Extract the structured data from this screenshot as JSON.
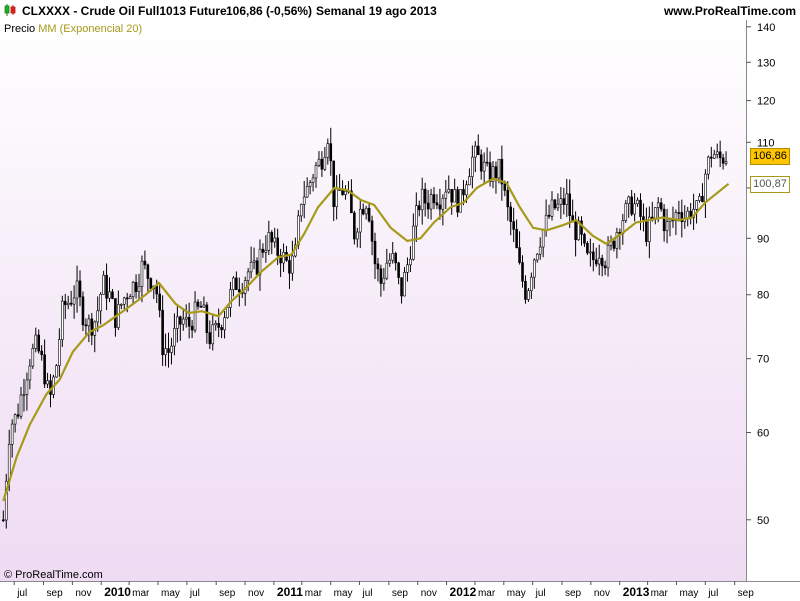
{
  "header": {
    "symbol": "CLXXXX - Crude Oil Full1013 Future",
    "price_change": "106,86 (-0,56%)",
    "period_date": "Semanal  19 ago 2013",
    "site": "www.ProRealTime.com"
  },
  "legend": {
    "price_label": "Precio",
    "ma_label": "MM (Exponencial 20)"
  },
  "copyright": "© ProRealTime.com",
  "colors": {
    "candle": "#000000",
    "ma": "#a69a18",
    "last_box": "#ffc600",
    "ma_box": "#ffffff"
  },
  "chart_data": {
    "type": "candlestick",
    "scale": "log",
    "ylim": [
      44,
      142
    ],
    "y_ticks": [
      140,
      130,
      120,
      110,
      100,
      90,
      80,
      70,
      60,
      50
    ],
    "x_ticks": [
      {
        "label": "jul",
        "x": "2009-07"
      },
      {
        "label": "sep",
        "x": "2009-09"
      },
      {
        "label": "nov",
        "x": "2009-11"
      },
      {
        "label": "2010",
        "x": "2010-01",
        "bold": true
      },
      {
        "label": "mar",
        "x": "2010-03"
      },
      {
        "label": "may",
        "x": "2010-05"
      },
      {
        "label": "jul",
        "x": "2010-07"
      },
      {
        "label": "sep",
        "x": "2010-09"
      },
      {
        "label": "nov",
        "x": "2010-11"
      },
      {
        "label": "2011",
        "x": "2011-01",
        "bold": true
      },
      {
        "label": "mar",
        "x": "2011-03"
      },
      {
        "label": "may",
        "x": "2011-05"
      },
      {
        "label": "jul",
        "x": "2011-07"
      },
      {
        "label": "sep",
        "x": "2011-09"
      },
      {
        "label": "nov",
        "x": "2011-11"
      },
      {
        "label": "2012",
        "x": "2012-01",
        "bold": true
      },
      {
        "label": "mar",
        "x": "2012-03"
      },
      {
        "label": "may",
        "x": "2012-05"
      },
      {
        "label": "jul",
        "x": "2012-07"
      },
      {
        "label": "sep",
        "x": "2012-09"
      },
      {
        "label": "nov",
        "x": "2012-11"
      },
      {
        "label": "2013",
        "x": "2013-01",
        "bold": true
      },
      {
        "label": "mar",
        "x": "2013-03"
      },
      {
        "label": "may",
        "x": "2013-05"
      },
      {
        "label": "jul",
        "x": "2013-07"
      },
      {
        "label": "sep",
        "x": "2013-09"
      }
    ],
    "close_series": {
      "name": "Precio",
      "points": [
        [
          "2009-06-08",
          50
        ],
        [
          "2009-06-22",
          61
        ],
        [
          "2009-07-06",
          62
        ],
        [
          "2009-07-20",
          66
        ],
        [
          "2009-08-03",
          70
        ],
        [
          "2009-08-17",
          72
        ],
        [
          "2009-08-31",
          69
        ],
        [
          "2009-09-14",
          64
        ],
        [
          "2009-09-28",
          69
        ],
        [
          "2009-10-12",
          78
        ],
        [
          "2009-10-26",
          79
        ],
        [
          "2009-11-09",
          81
        ],
        [
          "2009-11-23",
          77
        ],
        [
          "2009-12-07",
          75
        ],
        [
          "2009-12-21",
          76
        ],
        [
          "2010-01-04",
          82
        ],
        [
          "2010-01-18",
          80
        ],
        [
          "2010-02-01",
          76
        ],
        [
          "2010-02-15",
          79
        ],
        [
          "2010-03-01",
          81
        ],
        [
          "2010-03-15",
          82
        ],
        [
          "2010-03-29",
          85
        ],
        [
          "2010-04-12",
          83
        ],
        [
          "2010-04-26",
          82
        ],
        [
          "2010-05-10",
          72
        ],
        [
          "2010-05-24",
          71
        ],
        [
          "2010-06-07",
          74
        ],
        [
          "2010-06-21",
          76
        ],
        [
          "2010-07-05",
          75
        ],
        [
          "2010-07-19",
          77
        ],
        [
          "2010-08-02",
          78
        ],
        [
          "2010-08-16",
          73
        ],
        [
          "2010-08-30",
          74
        ],
        [
          "2010-09-13",
          76
        ],
        [
          "2010-09-27",
          79
        ],
        [
          "2010-10-11",
          82
        ],
        [
          "2010-10-25",
          82
        ],
        [
          "2010-11-08",
          84
        ],
        [
          "2010-11-22",
          84
        ],
        [
          "2010-12-06",
          88
        ],
        [
          "2010-12-20",
          90
        ],
        [
          "2011-01-03",
          88
        ],
        [
          "2011-01-17",
          87
        ],
        [
          "2011-01-31",
          85
        ],
        [
          "2011-02-14",
          86
        ],
        [
          "2011-02-28",
          98
        ],
        [
          "2011-03-14",
          100
        ],
        [
          "2011-03-28",
          104
        ],
        [
          "2011-04-11",
          106
        ],
        [
          "2011-04-25",
          112
        ],
        [
          "2011-05-09",
          96
        ],
        [
          "2011-05-23",
          100
        ],
        [
          "2011-06-06",
          98
        ],
        [
          "2011-06-20",
          91
        ],
        [
          "2011-07-04",
          96
        ],
        [
          "2011-07-18",
          98
        ],
        [
          "2011-08-01",
          86
        ],
        [
          "2011-08-15",
          82
        ],
        [
          "2011-08-29",
          86
        ],
        [
          "2011-09-12",
          86
        ],
        [
          "2011-09-26",
          80
        ],
        [
          "2011-10-10",
          85
        ],
        [
          "2011-10-24",
          92
        ],
        [
          "2011-11-07",
          98
        ],
        [
          "2011-11-21",
          97
        ],
        [
          "2011-12-05",
          99
        ],
        [
          "2011-12-19",
          98
        ],
        [
          "2012-01-02",
          101
        ],
        [
          "2012-01-16",
          98
        ],
        [
          "2012-01-30",
          97
        ],
        [
          "2012-02-13",
          103
        ],
        [
          "2012-02-27",
          107
        ],
        [
          "2012-03-12",
          106
        ],
        [
          "2012-03-26",
          103
        ],
        [
          "2012-04-09",
          103
        ],
        [
          "2012-04-23",
          104
        ],
        [
          "2012-05-07",
          96
        ],
        [
          "2012-05-21",
          91
        ],
        [
          "2012-06-04",
          84
        ],
        [
          "2012-06-18",
          80
        ],
        [
          "2012-07-02",
          86
        ],
        [
          "2012-07-16",
          90
        ],
        [
          "2012-07-30",
          93
        ],
        [
          "2012-08-13",
          96
        ],
        [
          "2012-08-27",
          96
        ],
        [
          "2012-09-10",
          98
        ],
        [
          "2012-09-24",
          92
        ],
        [
          "2012-10-08",
          91
        ],
        [
          "2012-10-22",
          86
        ],
        [
          "2012-11-05",
          86
        ],
        [
          "2012-11-19",
          88
        ],
        [
          "2012-12-03",
          86
        ],
        [
          "2012-12-17",
          89
        ],
        [
          "2012-12-31",
          93
        ],
        [
          "2013-01-14",
          95
        ],
        [
          "2013-01-28",
          97
        ],
        [
          "2013-02-11",
          95
        ],
        [
          "2013-02-25",
          91
        ],
        [
          "2013-03-11",
          93
        ],
        [
          "2013-03-25",
          97
        ],
        [
          "2013-04-08",
          92
        ],
        [
          "2013-04-22",
          93
        ],
        [
          "2013-05-06",
          96
        ],
        [
          "2013-05-20",
          94
        ],
        [
          "2013-06-03",
          96
        ],
        [
          "2013-06-17",
          95
        ],
        [
          "2013-07-01",
          103
        ],
        [
          "2013-07-15",
          108
        ],
        [
          "2013-07-29",
          106
        ],
        [
          "2013-08-12",
          107
        ],
        [
          "2013-08-19",
          106.86
        ]
      ]
    },
    "ma_series": {
      "name": "MM (Exponencial 20)",
      "points": [
        [
          "2009-06-08",
          52
        ],
        [
          "2009-07-06",
          57
        ],
        [
          "2009-08-03",
          61
        ],
        [
          "2009-09-07",
          65
        ],
        [
          "2009-10-05",
          67
        ],
        [
          "2009-11-02",
          71
        ],
        [
          "2009-12-07",
          74
        ],
        [
          "2010-01-04",
          75
        ],
        [
          "2010-02-01",
          76.5
        ],
        [
          "2010-03-01",
          78
        ],
        [
          "2010-04-05",
          80
        ],
        [
          "2010-05-03",
          82
        ],
        [
          "2010-06-07",
          78.5
        ],
        [
          "2010-07-05",
          77
        ],
        [
          "2010-08-02",
          77.3
        ],
        [
          "2010-09-06",
          76.5
        ],
        [
          "2010-10-04",
          79
        ],
        [
          "2010-11-01",
          81
        ],
        [
          "2010-12-06",
          84
        ],
        [
          "2011-01-10",
          86.5
        ],
        [
          "2011-02-07",
          87
        ],
        [
          "2011-03-07",
          91
        ],
        [
          "2011-04-04",
          96
        ],
        [
          "2011-05-09",
          100
        ],
        [
          "2011-06-06",
          99.5
        ],
        [
          "2011-07-04",
          97.5
        ],
        [
          "2011-08-01",
          96.5
        ],
        [
          "2011-09-05",
          92
        ],
        [
          "2011-10-10",
          89.5
        ],
        [
          "2011-11-07",
          90
        ],
        [
          "2011-12-05",
          93
        ],
        [
          "2012-01-09",
          96
        ],
        [
          "2012-02-06",
          97
        ],
        [
          "2012-03-05",
          100
        ],
        [
          "2012-04-09",
          102
        ],
        [
          "2012-05-07",
          101
        ],
        [
          "2012-06-04",
          96
        ],
        [
          "2012-07-02",
          92
        ],
        [
          "2012-07-30",
          91.5
        ],
        [
          "2012-09-03",
          92.5
        ],
        [
          "2012-10-01",
          93.5
        ],
        [
          "2012-11-05",
          90.5
        ],
        [
          "2012-12-03",
          89
        ],
        [
          "2013-01-07",
          91
        ],
        [
          "2013-02-04",
          93
        ],
        [
          "2013-03-04",
          93.5
        ],
        [
          "2013-04-01",
          94
        ],
        [
          "2013-05-06",
          93.5
        ],
        [
          "2013-06-03",
          94
        ],
        [
          "2013-07-01",
          97
        ],
        [
          "2013-08-19",
          100.87
        ]
      ]
    },
    "last_price": "106,86",
    "last_price_value": 106.86,
    "ma_value": "100,87",
    "ma_value_num": 100.87
  }
}
